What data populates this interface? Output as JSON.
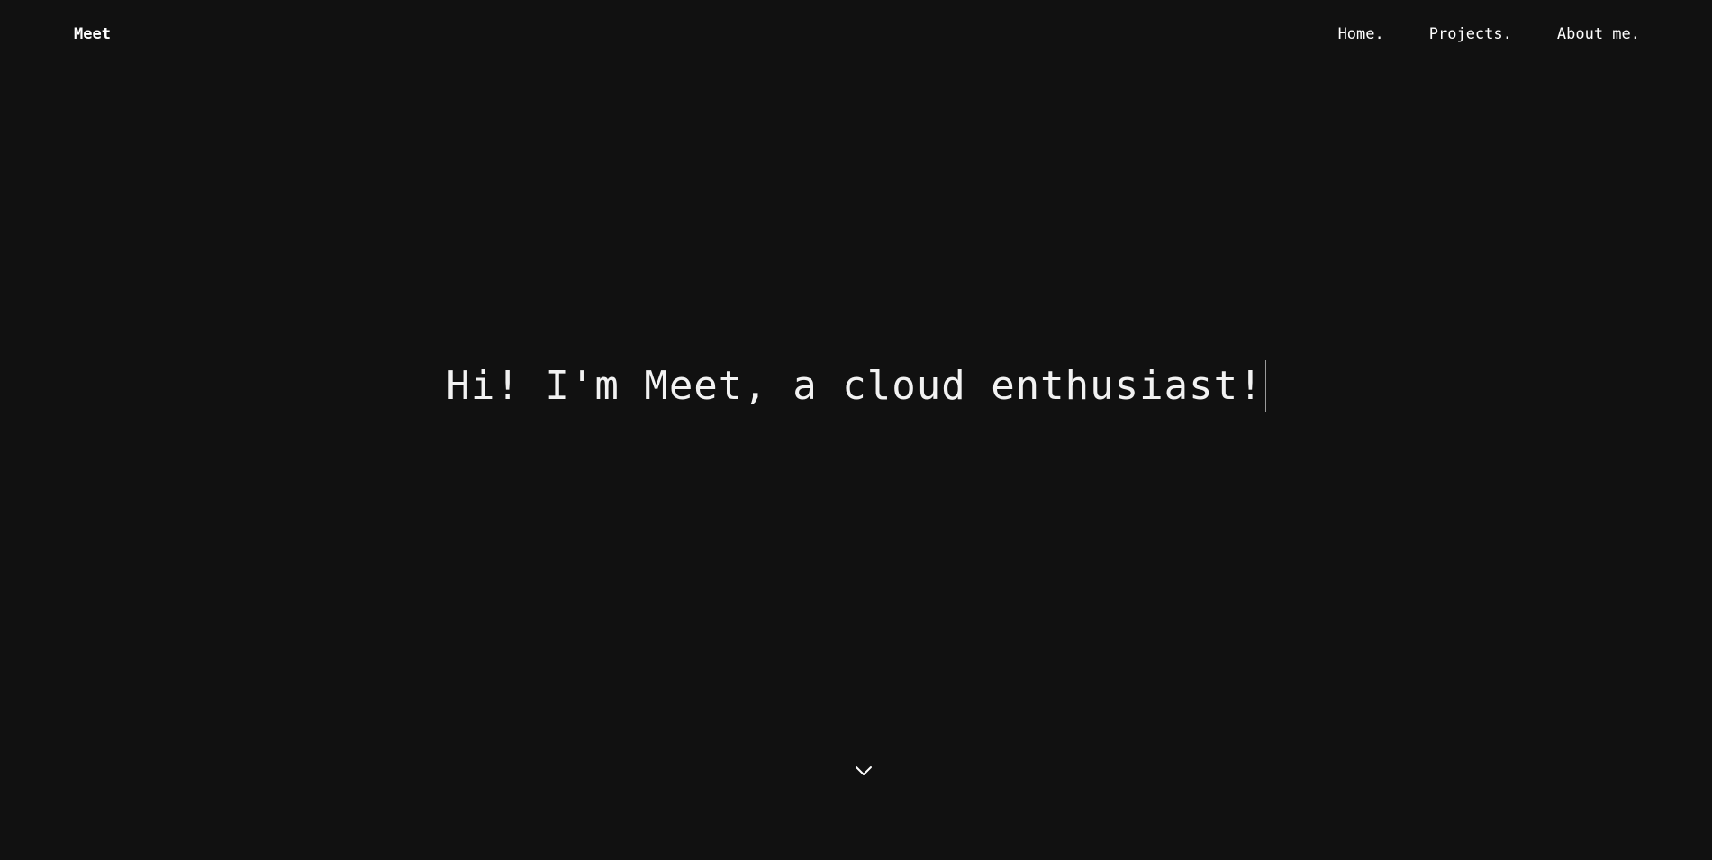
{
  "header": {
    "brand": "Meet",
    "nav": [
      {
        "label": "Home."
      },
      {
        "label": "Projects."
      },
      {
        "label": "About me."
      }
    ]
  },
  "hero": {
    "headline": "Hi! I'm Meet, a cloud enthusiast!"
  },
  "icons": {
    "scroll": "chevron-down-icon"
  },
  "colors": {
    "background": "#111111",
    "text": "#ffffff",
    "cursor": "#9a9a9a"
  }
}
